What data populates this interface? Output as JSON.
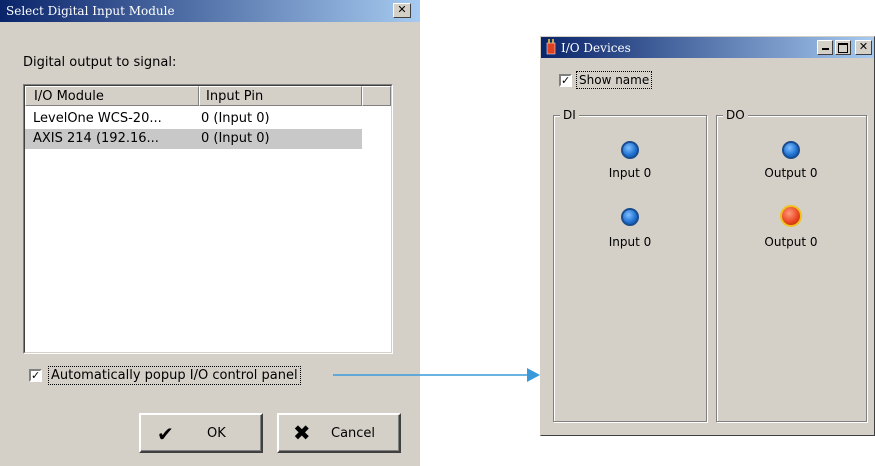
{
  "dialog": {
    "title": "Select Digital Input Module",
    "close_glyph": "✕",
    "prompt": "Digital output to signal:",
    "columns": [
      "I/O Module",
      "Input Pin"
    ],
    "rows": [
      {
        "module": "LevelOne WCS-20...",
        "pin": "0 (Input 0)"
      },
      {
        "module": "AXIS 214 (192.16...",
        "pin": "0 (Input 0)"
      }
    ],
    "selected_row": 1,
    "auto_popup": {
      "label": "Automatically popup I/O control panel",
      "checked": true
    },
    "ok_label": "OK",
    "cancel_label": "Cancel"
  },
  "io_window": {
    "title": "I/O Devices",
    "show_name": {
      "label": "Show name",
      "checked": true
    },
    "di": {
      "label": "DI",
      "items": [
        {
          "label": "Input 0",
          "state": "off",
          "color": "#1e6fd0"
        },
        {
          "label": "Input 0",
          "state": "off",
          "color": "#1e6fd0"
        }
      ]
    },
    "do": {
      "label": "DO",
      "items": [
        {
          "label": "Output 0",
          "state": "off",
          "color": "#1e6fd0"
        },
        {
          "label": "Output 0",
          "state": "on",
          "color": "#e8401c"
        }
      ]
    }
  },
  "colors": {
    "arrow": "#3a9ad9",
    "title_start": "#0a246a",
    "title_end": "#a6caf0",
    "face": "#d4d0c8"
  }
}
